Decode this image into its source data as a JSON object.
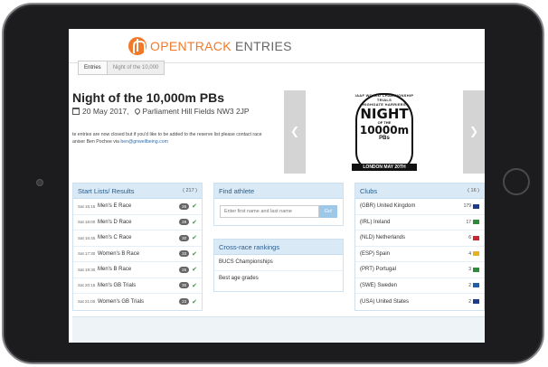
{
  "header": {
    "logo_open": "OPEN",
    "logo_track": "TRACK",
    "logo_entries": " ENTRIES"
  },
  "breadcrumb": {
    "home": "Entries",
    "current": "Night of the 10,000"
  },
  "event": {
    "title": "Night of the 10,000m PBs",
    "date": "20 May 2017,",
    "venue": "Parliament Hill Fields NW3 2JP",
    "notice_line1": "te entries are now closed but if you'd like to be added to the reserve list please contact race",
    "notice_line2": "aniser Ben Pochee via ",
    "notice_email": "ben@gnwellbeing.com"
  },
  "banner": {
    "arch": "IAAF WORLD CHAMPIONSHIP TRIALS",
    "harriers": "HIGHGATE HARRIERS",
    "night": "NIGHT",
    "of_the": "OF THE",
    "distance": "10000m",
    "pbs": "PBs",
    "date": "LONDON MAY 20TH"
  },
  "start_lists": {
    "title": "Start Lists/ Results",
    "count": "( 217 )",
    "rows": [
      {
        "time": "Sat 15:15",
        "name": "Men's E Race",
        "entries": "26"
      },
      {
        "time": "Sat 16:00",
        "name": "Men's D Race",
        "entries": "28"
      },
      {
        "time": "Sat 16:45",
        "name": "Men's C Race",
        "entries": "30"
      },
      {
        "time": "Sat 17:30",
        "name": "Women's B Race",
        "entries": "33"
      },
      {
        "time": "Sat 19:30",
        "name": "Men's B Race",
        "entries": "26"
      },
      {
        "time": "Sat 20:15",
        "name": "Men's GB Trials",
        "entries": "30"
      },
      {
        "time": "Sat 21:00",
        "name": "Women's GB Trials",
        "entries": "23"
      }
    ]
  },
  "find_athlete": {
    "title": "Find athlete",
    "placeholder": "Enter first name and last name",
    "go": "Go!"
  },
  "cross_race": {
    "title": "Cross-race rankings",
    "items": [
      "BUCS Championships",
      "Best age grades"
    ]
  },
  "clubs": {
    "title": "Clubs",
    "count": "( 16 )",
    "rows": [
      {
        "name": "(GBR) United Kingdom",
        "count": "179",
        "color": "#1f3b8c"
      },
      {
        "name": "(IRL) Ireland",
        "count": "17",
        "color": "#2e8b3a"
      },
      {
        "name": "(NLD) Netherlands",
        "count": "6",
        "color": "#c8282e"
      },
      {
        "name": "(ESP) Spain",
        "count": "4",
        "color": "#e8b020"
      },
      {
        "name": "(PRT) Portugal",
        "count": "3",
        "color": "#2e8b3a"
      },
      {
        "name": "(SWE) Sweden",
        "count": "2",
        "color": "#1f5fa8"
      },
      {
        "name": "(USA) United States",
        "count": "2",
        "color": "#1f3b8c"
      }
    ]
  }
}
